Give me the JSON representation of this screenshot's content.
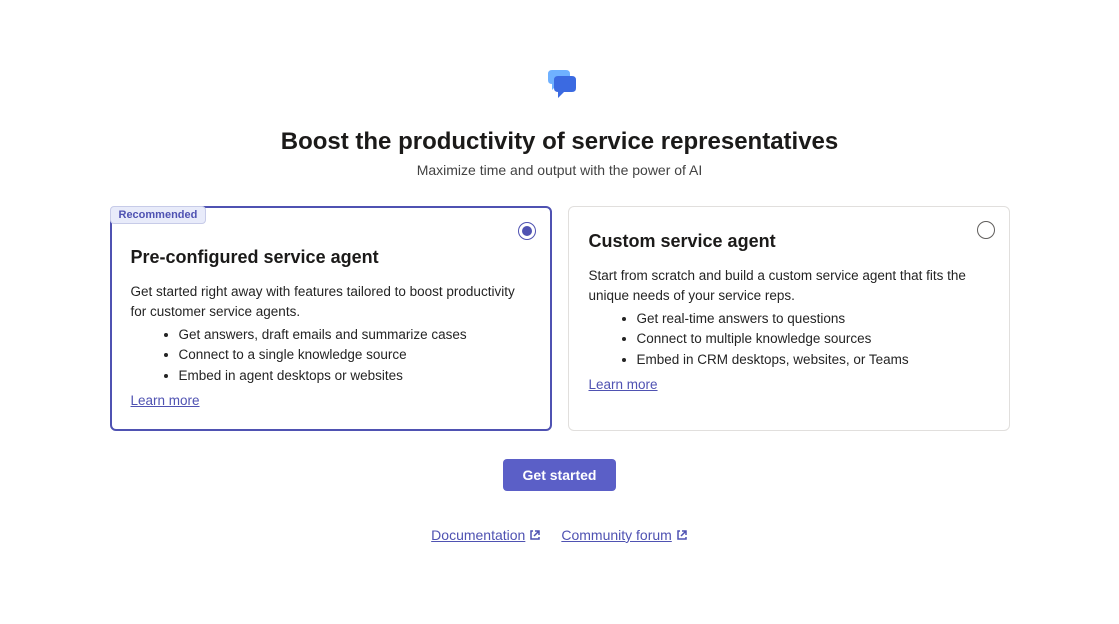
{
  "header": {
    "title": "Boost the productivity of service representatives",
    "subtitle": "Maximize time and output with the power of AI"
  },
  "cards": {
    "preconfigured": {
      "badge": "Recommended",
      "title": "Pre-configured service agent",
      "description": "Get started right away with features tailored to boost productivity for customer service agents.",
      "bullets": [
        "Get answers, draft emails and summarize cases",
        "Connect to a single knowledge source",
        "Embed in agent desktops or websites"
      ],
      "learn_more": "Learn more",
      "selected": true
    },
    "custom": {
      "title": "Custom service agent",
      "description": "Start from scratch and build a custom service agent that fits the unique needs of your service reps.",
      "bullets": [
        "Get real-time answers to questions",
        "Connect to multiple knowledge sources",
        "Embed in CRM desktops, websites, or Teams"
      ],
      "learn_more": "Learn more",
      "selected": false
    }
  },
  "primary_button": "Get started",
  "footer": {
    "documentation": "Documentation",
    "community": "Community forum"
  }
}
